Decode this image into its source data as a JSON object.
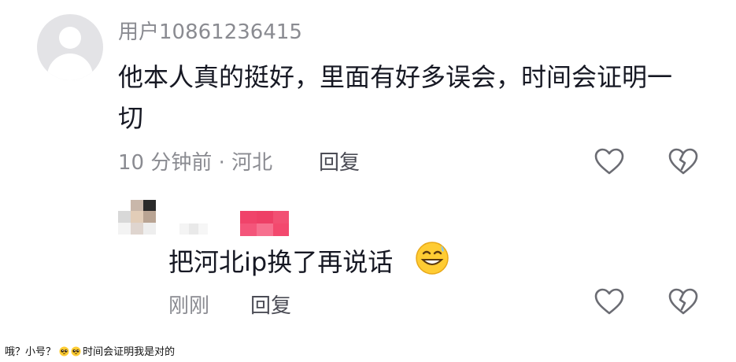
{
  "comment": {
    "username": "用户10861236415",
    "text": "他本人真的挺好，里面有好多误会，时间会证明一切",
    "time_location": "10 分钟前 · 河北",
    "reply_label": "回复",
    "like_icon": "heart-outline-icon",
    "dislike_icon": "broken-heart-icon"
  },
  "reply": {
    "text": "把河北ip换了再说话",
    "emoji": "grinning-sweat-emoji",
    "time": "刚刚",
    "reply_label": "回复"
  },
  "caption": {
    "prefix": "哦？小号？",
    "emojis": [
      "pleading-face-emoji",
      "pleading-face-emoji"
    ],
    "suffix": "时间会证明我是对的"
  },
  "colors": {
    "text_primary": "#161823",
    "text_secondary": "#8a8b91",
    "avatar_bg": "#e3e3e6",
    "mosaic_pink": "#f0436a"
  }
}
